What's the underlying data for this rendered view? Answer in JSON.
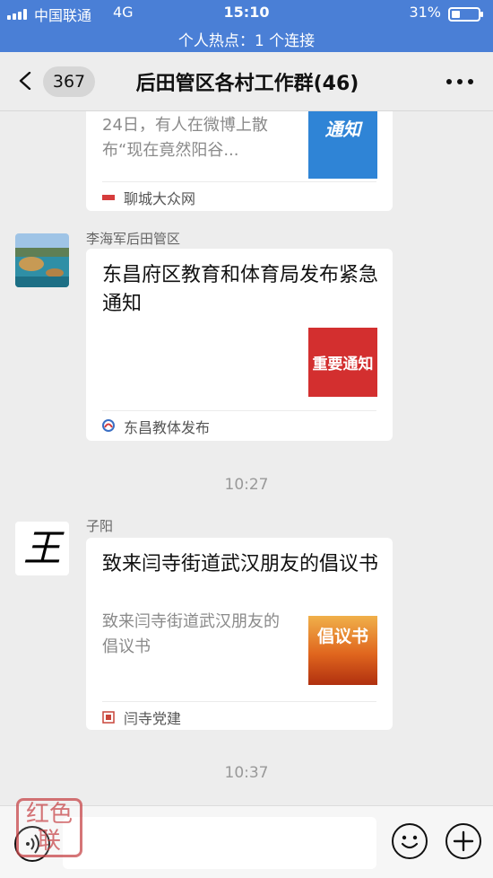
{
  "status_bar": {
    "carrier": "中国联通",
    "network": "4G",
    "time": "15:10",
    "battery_percent": "31%",
    "battery_level": 0.31,
    "signal_bars": 4
  },
  "hotspot_banner": "个人热点：1 个连接",
  "header": {
    "unread_count": "367",
    "title": "后田管区各村工作群(46)",
    "back_icon": "chevron-left-icon",
    "more_icon": "more-dots-icon"
  },
  "messages": [
    {
      "type": "article",
      "description": "24日，有人在微博上散布“现在竟然阳谷...",
      "thumbnail_text": "通知",
      "thumbnail_color": "#2f84d6",
      "source_name": "聊城大众网"
    },
    {
      "type": "article",
      "sender": "李海军后田管区",
      "title": "东昌府区教育和体育局发布紧急通知",
      "thumbnail_text": "重要通知",
      "thumbnail_color": "#d32f2f",
      "source_name": "东昌教体发布"
    },
    {
      "type": "timestamp",
      "time": "10:27"
    },
    {
      "type": "article",
      "sender": "子阳",
      "avatar_text": "王",
      "title": "致来闫寺街道武汉朋友的倡议书",
      "description": "致来闫寺街道武汉朋友的倡议书",
      "thumbnail_text": "倡议书",
      "thumbnail_color": "#d8481c",
      "source_name": "闫寺党建"
    },
    {
      "type": "timestamp",
      "time": "10:37"
    }
  ],
  "input_bar": {
    "voice_icon": "voice-icon",
    "emoji_icon": "emoji-icon",
    "plus_icon": "plus-icon",
    "input_value": ""
  },
  "watermark_text": "红色联"
}
